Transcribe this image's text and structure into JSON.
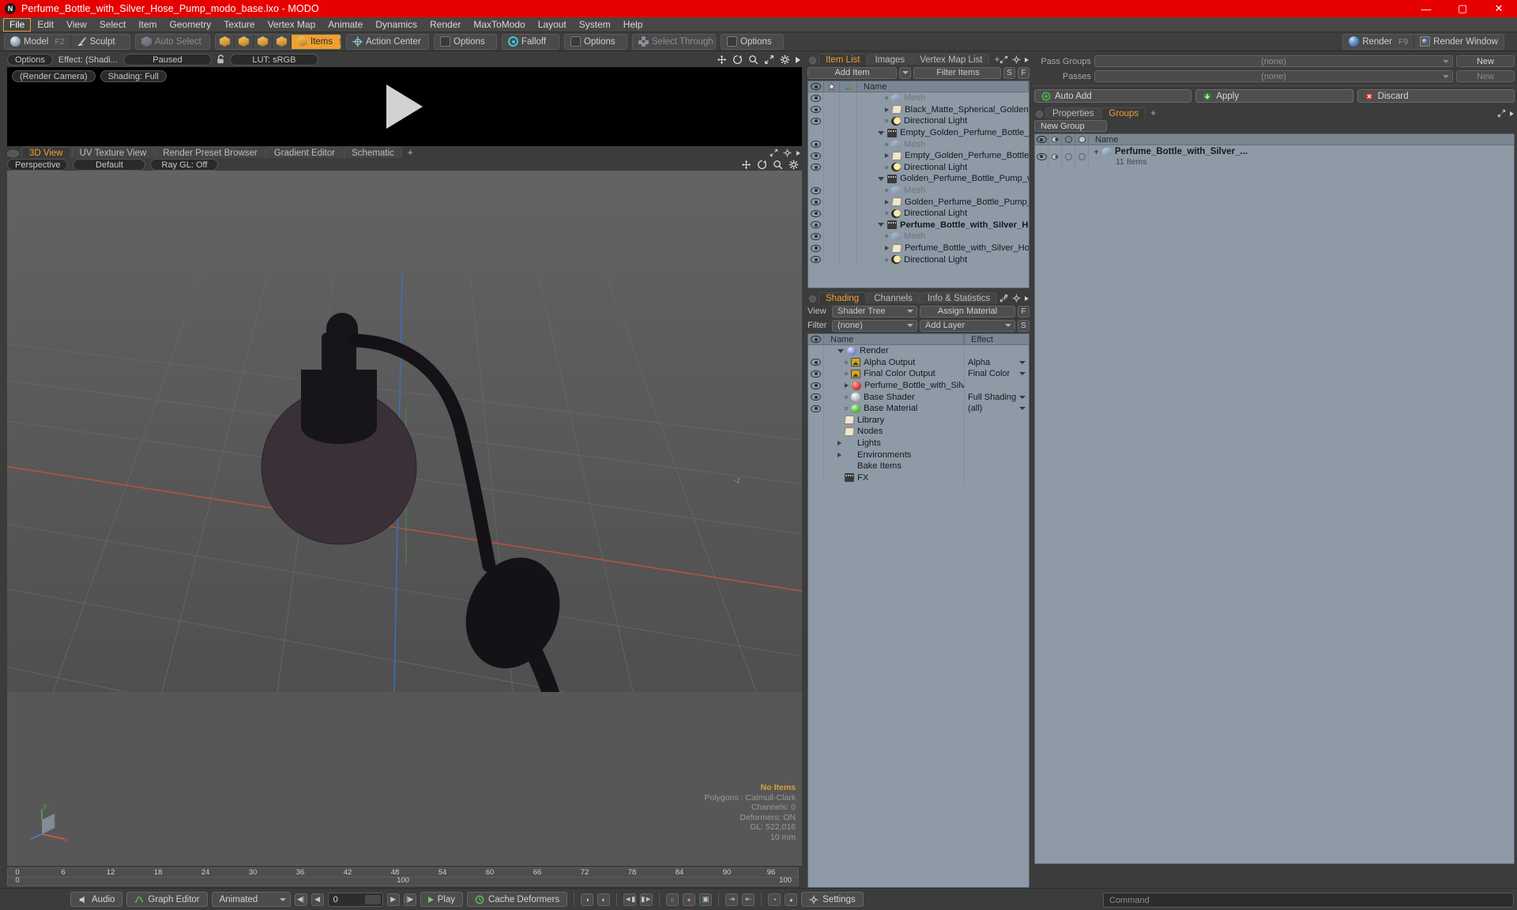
{
  "window": {
    "title": "Perfume_Bottle_with_Silver_Hose_Pump_modo_base.lxo - MODO",
    "logo": "N",
    "minimize": "—",
    "maximize": "▢",
    "close": "✕"
  },
  "menu": {
    "items": [
      "File",
      "Edit",
      "View",
      "Select",
      "Item",
      "Geometry",
      "Texture",
      "Vertex Map",
      "Animate",
      "Dynamics",
      "Render",
      "MaxToModo",
      "Layout",
      "System",
      "Help"
    ],
    "active": "File"
  },
  "toolbar": {
    "mode_model": "Model",
    "mode_model_key": "F2",
    "mode_sculpt": "Sculpt",
    "auto_select": "Auto Select",
    "items": "Items",
    "items_key": "5",
    "action_center": "Action Center",
    "options1": "Options",
    "falloff": "Falloff",
    "options2": "Options",
    "select_through": "Select Through",
    "options3": "Options",
    "render": "Render",
    "render_key": "F9",
    "render_window": "Render Window"
  },
  "preview": {
    "options": "Options",
    "effect": "Effect: (Shadi...",
    "paused": "Paused",
    "lut": "LUT: sRGB",
    "render_camera": "(Render Camera)",
    "shading": "Shading: Full"
  },
  "viewport": {
    "tabs": [
      "3D View",
      "UV Texture View",
      "Render Preset Browser",
      "Gradient Editor",
      "Schematic"
    ],
    "active_tab": "3D View",
    "plus": "+",
    "perspective": "Perspective",
    "default": "Default",
    "raygl": "Ray GL: Off",
    "axis_label": "-z",
    "hud": {
      "no_items": "No Items",
      "polygons": "Polygons : Catmull-Clark",
      "channels": "Channels: 0",
      "deformers": "Deformers: ON",
      "gl": "GL: 522,016",
      "units": "10 mm"
    },
    "ruler_top": [
      "0",
      "6",
      "12",
      "18",
      "24",
      "30",
      "36",
      "42",
      "48",
      "54",
      "60",
      "66",
      "72",
      "78",
      "84",
      "90",
      "96"
    ],
    "ruler_bottom_left": "0",
    "ruler_bottom_mid": "100",
    "ruler_bottom_right": "100"
  },
  "item_list": {
    "tabs": [
      "Item List",
      "Images",
      "Vertex Map List"
    ],
    "active_tab": "Item List",
    "plus": "+",
    "add_item": "Add Item",
    "filter_items": "Filter Items",
    "btn_s": "S",
    "btn_f": "F",
    "header_name": "Name",
    "rows": [
      {
        "label": "Mesh",
        "indent": 3,
        "icon": "mesh-icon",
        "dim": true,
        "eye": true,
        "marker": "dot"
      },
      {
        "label": "Black_Matte_Spherical_Golden_Perfu ...",
        "indent": 3,
        "icon": "folder-icon",
        "dim": false,
        "eye": true,
        "marker": "tri"
      },
      {
        "label": "Directional Light",
        "indent": 3,
        "icon": "light-icon",
        "dim": false,
        "eye": true,
        "marker": "dot"
      },
      {
        "label": "Empty_Golden_Perfume_Bottle_with_Ho...",
        "indent": 2,
        "icon": "film-icon",
        "dim": false,
        "eye": false,
        "marker": "tridown"
      },
      {
        "label": "Mesh",
        "indent": 3,
        "icon": "mesh-icon",
        "dim": true,
        "eye": true,
        "marker": "dot"
      },
      {
        "label": "Empty_Golden_Perfume_Bottle_with_...",
        "indent": 3,
        "icon": "folder-icon",
        "dim": false,
        "eye": true,
        "marker": "tri"
      },
      {
        "label": "Directional Light",
        "indent": 3,
        "icon": "light-icon",
        "dim": false,
        "eye": true,
        "marker": "dot"
      },
      {
        "label": "Golden_Perfume_Bottle_Pump_with_Ho ...",
        "indent": 2,
        "icon": "film-icon",
        "dim": false,
        "eye": false,
        "marker": "tridown"
      },
      {
        "label": "Mesh",
        "indent": 3,
        "icon": "mesh-icon",
        "dim": true,
        "eye": true,
        "marker": "dot"
      },
      {
        "label": "Golden_Perfume_Bottle_Pump_with_ ...",
        "indent": 3,
        "icon": "folder-icon",
        "dim": false,
        "eye": true,
        "marker": "tri"
      },
      {
        "label": "Directional Light",
        "indent": 3,
        "icon": "light-icon",
        "dim": false,
        "eye": true,
        "marker": "dot"
      },
      {
        "label": "Perfume_Bottle_with_Silver_Hose...",
        "indent": 2,
        "icon": "film-icon",
        "dim": false,
        "eye": true,
        "marker": "tridown",
        "selected": true
      },
      {
        "label": "Mesh",
        "indent": 3,
        "icon": "mesh-icon",
        "dim": true,
        "eye": true,
        "marker": "dot"
      },
      {
        "label": "Perfume_Bottle_with_Silver_Hose_Pu ...",
        "indent": 3,
        "icon": "folder-icon",
        "dim": false,
        "eye": true,
        "marker": "tri"
      },
      {
        "label": "Directional Light",
        "indent": 3,
        "icon": "light-icon",
        "dim": false,
        "eye": true,
        "marker": "dot"
      }
    ]
  },
  "shading": {
    "tabs": [
      "Shading",
      "Channels",
      "Info & Statistics"
    ],
    "active_tab": "Shading",
    "plus": "+",
    "view_label": "View",
    "view_value": "Shader Tree",
    "assign_material": "Assign Material",
    "btn_f": "F",
    "filter_label": "Filter",
    "filter_value": "(none)",
    "add_layer": "Add Layer",
    "btn_s": "S",
    "header_name": "Name",
    "header_effect": "Effect",
    "rows": [
      {
        "label": "Render",
        "effect": "",
        "indent": 1,
        "icon": "render-globe-icon",
        "marker": "tridown",
        "eye": false
      },
      {
        "label": "Alpha Output",
        "effect": "Alpha",
        "indent": 2,
        "icon": "image-icon",
        "marker": "dot",
        "eye": true
      },
      {
        "label": "Final Color Output",
        "effect": "Final Color",
        "indent": 2,
        "icon": "image-icon",
        "marker": "dot",
        "eye": true
      },
      {
        "label": "Perfume_Bottle_with_Silve...",
        "effect": "",
        "indent": 2,
        "icon": "material-red-icon",
        "marker": "tri",
        "eye": true,
        "caret": true
      },
      {
        "label": "Base Shader",
        "effect": "Full Shading",
        "indent": 2,
        "icon": "shader-grey-icon",
        "marker": "dot",
        "eye": true
      },
      {
        "label": "Base Material",
        "effect": "(all)",
        "indent": 2,
        "icon": "material-green-icon",
        "marker": "dot",
        "eye": true
      },
      {
        "label": "Library",
        "effect": "",
        "indent": 1,
        "icon": "folder-icon",
        "marker": "none",
        "eye": false
      },
      {
        "label": "Nodes",
        "effect": "",
        "indent": 1,
        "icon": "folder-icon",
        "marker": "none",
        "eye": false
      },
      {
        "label": "Lights",
        "effect": "",
        "indent": 1,
        "icon": "none",
        "marker": "tri",
        "eye": false
      },
      {
        "label": "Environments",
        "effect": "",
        "indent": 1,
        "icon": "none",
        "marker": "tri",
        "eye": false
      },
      {
        "label": "Bake Items",
        "effect": "",
        "indent": 1,
        "icon": "none",
        "marker": "none",
        "eye": false
      },
      {
        "label": "FX",
        "effect": "",
        "indent": 1,
        "icon": "film-icon",
        "marker": "none",
        "eye": false
      }
    ]
  },
  "passes": {
    "pass_groups_label": "Pass Groups",
    "pass_groups_value": "(none)",
    "pass_groups_new": "New",
    "passes_label": "Passes",
    "passes_value": "(none)",
    "passes_new": "New",
    "auto_add": "Auto Add",
    "apply": "Apply",
    "discard": "Discard"
  },
  "groups": {
    "tabs": [
      "Properties",
      "Groups"
    ],
    "active_tab": "Groups",
    "plus": "+",
    "new_group": "New Group",
    "header_name": "Name",
    "row_title": "Perfume_Bottle_with_Silver_...",
    "row_sub": "11 Items",
    "expander": "+"
  },
  "bottom": {
    "audio": "Audio",
    "graph_editor": "Graph Editor",
    "animated": "Animated",
    "frame_value": "0",
    "play": "Play",
    "cache_deformers": "Cache Deformers",
    "settings": "Settings",
    "command_placeholder": "Command"
  },
  "colors": {
    "accent": "#f0a030",
    "title_bar": "#e60000",
    "panel_bg": "#3c3c3c",
    "tree_bg": "#8e9aa6",
    "viewport_bg": "#575757"
  }
}
